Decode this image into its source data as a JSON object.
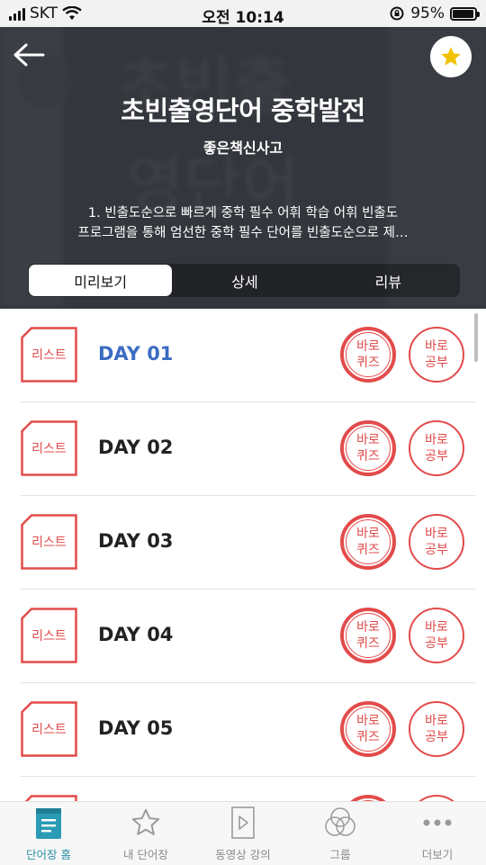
{
  "status_bar": {
    "carrier": "SKT",
    "time": "오전 10:14",
    "battery": "95%",
    "battery_level": 0.95
  },
  "header": {
    "title": "초빈출영단어 중학발전",
    "publisher": "좋은책신사고",
    "description_lines": [
      "1. 빈출도순으로 빠르게 중학 필수 어휘 학습 어휘 빈출도",
      "프로그램을 통해 엄선한 중학 필수 단어를 빈출도순으로 제…"
    ],
    "icons": {
      "back": "arrow-left-icon",
      "favorite": "star-icon"
    },
    "accent_color": "#f2c200"
  },
  "tabs": [
    {
      "label": "미리보기",
      "active": true
    },
    {
      "label": "상세",
      "active": false
    },
    {
      "label": "리뷰",
      "active": false
    }
  ],
  "list": {
    "icon_label": "리스트",
    "quiz_label_1": "바로",
    "quiz_label_2": "퀴즈",
    "study_label_1": "바로",
    "study_label_2": "공부",
    "days": [
      {
        "label": "DAY 01",
        "current": true
      },
      {
        "label": "DAY 02",
        "current": false
      },
      {
        "label": "DAY 03",
        "current": false
      },
      {
        "label": "DAY 04",
        "current": false
      },
      {
        "label": "DAY 05",
        "current": false
      },
      {
        "label": "",
        "current": false
      }
    ],
    "colors": {
      "red": "#e34b4b",
      "current_day": "#3b6cc2"
    }
  },
  "bottom_nav": [
    {
      "label": "단어장 홈",
      "icon": "book-icon",
      "active": true
    },
    {
      "label": "내 단어장",
      "icon": "star-outline-icon",
      "active": false
    },
    {
      "label": "동영상 강의",
      "icon": "video-icon",
      "active": false
    },
    {
      "label": "그룹",
      "icon": "group-icon",
      "active": false
    },
    {
      "label": "더보기",
      "icon": "more-icon",
      "active": false
    }
  ]
}
